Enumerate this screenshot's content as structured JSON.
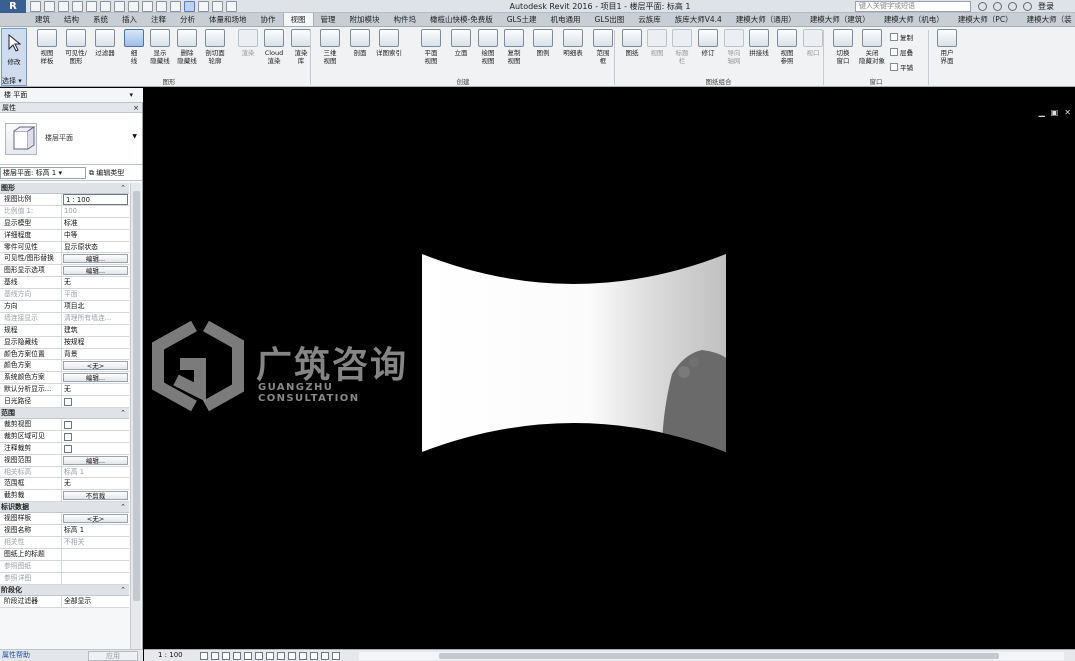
{
  "titlebar": {
    "title": "Autodesk Revit 2016 -    项目1 - 楼层平面: 标高 1",
    "search_placeholder": "键入关键字或短语",
    "login": "登录"
  },
  "tabs": [
    "建筑",
    "结构",
    "系统",
    "插入",
    "注释",
    "分析",
    "体量和场地",
    "协作",
    "视图",
    "管理",
    "附加模块",
    "构件坞",
    "橄榄山快模-免费版",
    "GLS土建",
    "机电通用",
    "GLS出图",
    "云族库",
    "族库大师V4.4",
    "建模大师（通用）",
    "建模大师（建筑）",
    "建模大师（机电）",
    "建模大师（PC）",
    "建模大师（装"
  ],
  "active_tab_index": 8,
  "ribbon": {
    "modify": "修改",
    "buttons": [
      {
        "label": "视图\n样板",
        "state": "normal"
      },
      {
        "label": "可见性/\n图形",
        "state": "normal"
      },
      {
        "label": "过滤器",
        "state": "normal"
      },
      {
        "label": "细\n线",
        "state": "selected"
      },
      {
        "label": "显示\n隐藏线",
        "state": "normal"
      },
      {
        "label": "删除\n隐藏线",
        "state": "normal"
      },
      {
        "label": "剖切面\n轮廓",
        "state": "normal"
      },
      {
        "label": "渲染",
        "state": "disabled"
      },
      {
        "label": "Cloud\n渲染",
        "state": "normal"
      },
      {
        "label": "渲染\n库",
        "state": "normal"
      },
      {
        "label": "三维\n视图",
        "state": "normal"
      },
      {
        "label": "剖面",
        "state": "normal"
      },
      {
        "label": "详图索引",
        "state": "normal"
      },
      {
        "label": "平面\n视图",
        "state": "normal"
      },
      {
        "label": "立面",
        "state": "normal"
      },
      {
        "label": "绘图\n视图",
        "state": "normal"
      },
      {
        "label": "复制\n视图",
        "state": "normal"
      },
      {
        "label": "图例",
        "state": "normal"
      },
      {
        "label": "明细表",
        "state": "normal"
      },
      {
        "label": "范围\n框",
        "state": "normal"
      },
      {
        "label": "图纸",
        "state": "normal"
      },
      {
        "label": "视图",
        "state": "disabled"
      },
      {
        "label": "标题\n栏",
        "state": "disabled"
      },
      {
        "label": "修订",
        "state": "normal"
      },
      {
        "label": "导向\n轴网",
        "state": "disabled"
      },
      {
        "label": "拼接线",
        "state": "normal"
      },
      {
        "label": "视图\n参照",
        "state": "normal"
      },
      {
        "label": "视口",
        "state": "disabled"
      },
      {
        "label": "切换\n窗口",
        "state": "normal"
      },
      {
        "label": "关闭\n隐藏对象",
        "state": "normal"
      },
      {
        "label": "用户\n界面",
        "state": "normal"
      }
    ],
    "small_buttons": [
      "复制",
      "层叠",
      "平铺"
    ],
    "groups": [
      "图形",
      "创建",
      "图纸组合",
      "窗口"
    ]
  },
  "select_label": "选择 ▾",
  "type_row": "楼    平面",
  "properties": {
    "title": "属性",
    "type_name": "楼层平面",
    "instance_selector": "楼层平面: 标高 1",
    "edit_type": "编辑类型",
    "sections": [
      {
        "name": "图形",
        "rows": [
          {
            "k": "视图比例",
            "v": "1 : 100",
            "kind": "input"
          },
          {
            "k": "比例值 1:",
            "v": "100",
            "kind": "text",
            "dis": true
          },
          {
            "k": "显示模型",
            "v": "标准",
            "kind": "text"
          },
          {
            "k": "详细程度",
            "v": "中等",
            "kind": "text"
          },
          {
            "k": "零件可见性",
            "v": "显示原状态",
            "kind": "text"
          },
          {
            "k": "可见性/图形替换",
            "v": "编辑...",
            "kind": "button"
          },
          {
            "k": "图形显示选项",
            "v": "编辑...",
            "kind": "button"
          },
          {
            "k": "基线",
            "v": "无",
            "kind": "text"
          },
          {
            "k": "基线方向",
            "v": "平面",
            "kind": "text",
            "dis": true
          },
          {
            "k": "方向",
            "v": "项目北",
            "kind": "text"
          },
          {
            "k": "墙连接显示",
            "v": "清理所有墙连...",
            "kind": "text",
            "dis": true
          },
          {
            "k": "规程",
            "v": "建筑",
            "kind": "text"
          },
          {
            "k": "显示隐藏线",
            "v": "按规程",
            "kind": "text"
          },
          {
            "k": "颜色方案位置",
            "v": "背景",
            "kind": "text"
          },
          {
            "k": "颜色方案",
            "v": "<无>",
            "kind": "button"
          },
          {
            "k": "系统颜色方案",
            "v": "编辑...",
            "kind": "button"
          },
          {
            "k": "默认分析显示...",
            "v": "无",
            "kind": "text"
          },
          {
            "k": "日光路径",
            "v": "",
            "kind": "checkbox"
          }
        ]
      },
      {
        "name": "范围",
        "rows": [
          {
            "k": "裁剪视图",
            "v": "",
            "kind": "checkbox"
          },
          {
            "k": "裁剪区域可见",
            "v": "",
            "kind": "checkbox"
          },
          {
            "k": "注释裁剪",
            "v": "",
            "kind": "checkbox"
          },
          {
            "k": "视图范围",
            "v": "编辑...",
            "kind": "button"
          },
          {
            "k": "相关标高",
            "v": "标高 1",
            "kind": "text",
            "dis": true
          },
          {
            "k": "范围框",
            "v": "无",
            "kind": "text"
          },
          {
            "k": "截剪裁",
            "v": "不剪裁",
            "kind": "button"
          }
        ]
      },
      {
        "name": "标识数据",
        "rows": [
          {
            "k": "视图样板",
            "v": "<无>",
            "kind": "button"
          },
          {
            "k": "视图名称",
            "v": "标高 1",
            "kind": "text"
          },
          {
            "k": "相关性",
            "v": "不相关",
            "kind": "text",
            "dis": true
          },
          {
            "k": "图纸上的标题",
            "v": "",
            "kind": "text"
          },
          {
            "k": "参照图纸",
            "v": "",
            "kind": "text",
            "dis": true
          },
          {
            "k": "参照详图",
            "v": "",
            "kind": "text",
            "dis": true
          }
        ]
      },
      {
        "name": "阶段化",
        "rows": [
          {
            "k": "阶段过滤器",
            "v": "全部显示",
            "kind": "text"
          }
        ]
      }
    ],
    "help": "属性帮助",
    "apply": "应用"
  },
  "viewbar": {
    "scale": "1 : 100"
  },
  "watermark": {
    "cn": "广筑咨询",
    "en": "GUANGZHU CONSULTATION"
  }
}
